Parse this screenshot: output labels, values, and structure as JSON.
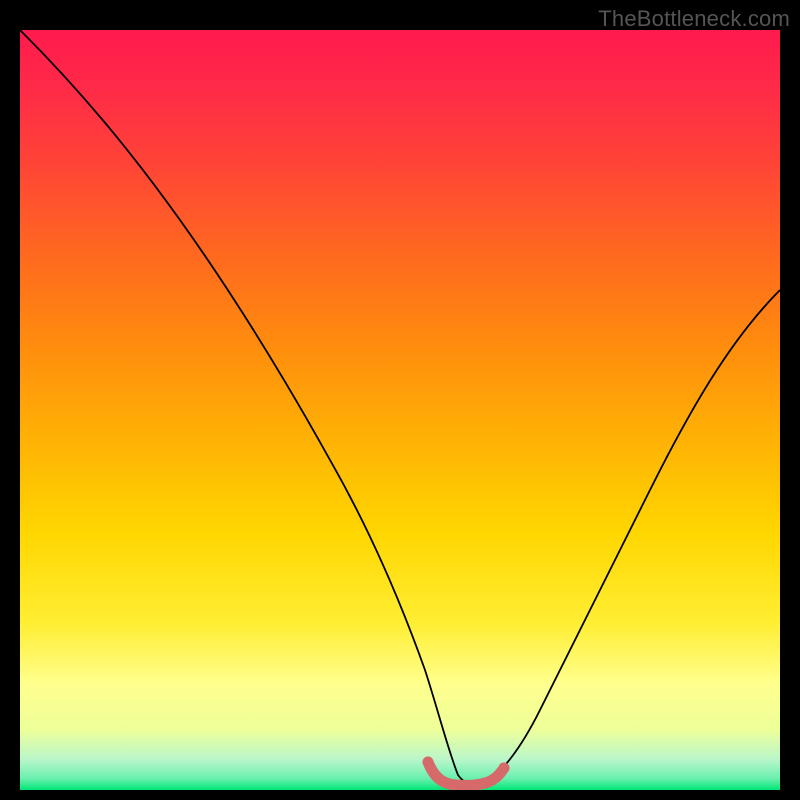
{
  "watermark": "TheBottleneck.com",
  "chart_data": {
    "type": "line",
    "title": "",
    "xlabel": "",
    "ylabel": "",
    "xlim": [
      0,
      100
    ],
    "ylim": [
      0,
      100
    ],
    "x": [
      0,
      5,
      10,
      15,
      20,
      25,
      30,
      35,
      40,
      45,
      50,
      52,
      54,
      56,
      58,
      60,
      62,
      65,
      70,
      75,
      80,
      85,
      90,
      95,
      100
    ],
    "y": [
      100,
      93,
      86,
      79,
      72,
      64,
      57,
      49,
      41,
      33,
      24,
      14,
      6,
      2,
      1,
      1,
      2,
      4,
      12,
      22,
      33,
      43,
      52,
      59,
      63
    ],
    "gradient_colors": {
      "top": "#ff1744",
      "upper_mid": "#ff6d00",
      "mid": "#ffd600",
      "lower_mid": "#ffff8d",
      "bottom": "#00e676"
    },
    "marker_segment": {
      "color": "#e57373",
      "x_range": [
        52,
        62
      ],
      "y_value": 1,
      "description": "thick red highlight at curve minimum"
    },
    "annotations": []
  }
}
